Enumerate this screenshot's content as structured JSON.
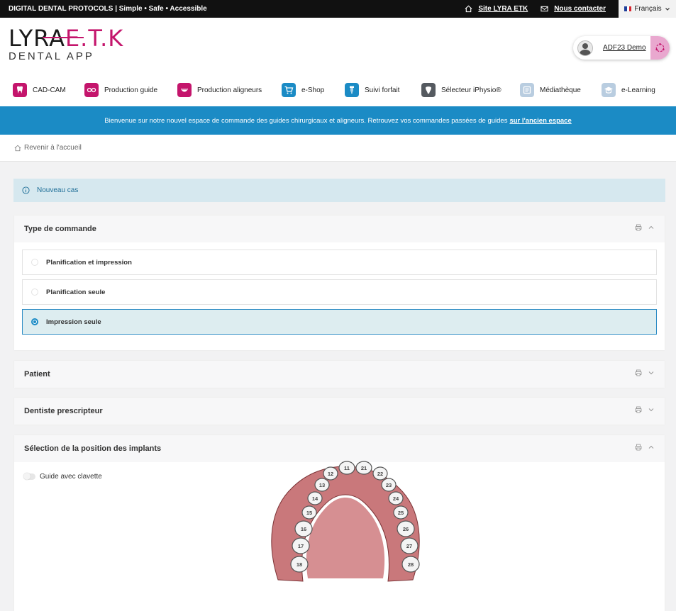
{
  "topbar": {
    "tagline": "DIGITAL DENTAL PROTOCOLS | Simple • Safe • Accessible",
    "site_link": "Site LYRA ETK",
    "contact_link": "Nous contacter",
    "language": "Français"
  },
  "brand": {
    "logo_line1": "LYRA",
    "logo_line1b": "E.T.K",
    "logo_line2": "DENTAL APP",
    "accent": "#c4156c"
  },
  "user": {
    "name": "ADF23 Demo"
  },
  "nav": [
    {
      "label": "CAD-CAM",
      "icon": "tooth-icon",
      "color": "#c4156c"
    },
    {
      "label": "Production guide",
      "icon": "guide-icon",
      "color": "#c4156c"
    },
    {
      "label": "Production aligneurs",
      "icon": "smile-icon",
      "color": "#c4156c"
    },
    {
      "label": "e-Shop",
      "icon": "cart-icon",
      "color": "#1b8bc5"
    },
    {
      "label": "Suivi forfait",
      "icon": "implant-icon",
      "color": "#1b8bc5"
    },
    {
      "label": "Sélecteur iPhysio®",
      "icon": "iphysio-icon",
      "color": "#555a60"
    },
    {
      "label": "Médiathèque",
      "icon": "media-icon",
      "color": "#b9cde0"
    },
    {
      "label": "e-Learning",
      "icon": "graduation-cap-icon",
      "color": "#b9cde0"
    }
  ],
  "banner": {
    "text": "Bienvenue sur notre nouvel espace de commande des guides chirurgicaux et aligneurs. Retrouvez vos commandes passées de guides",
    "link": "sur l'ancien espace"
  },
  "breadcrumb": {
    "back": "Revenir à l'accueil"
  },
  "alert": {
    "text": "Nouveau cas"
  },
  "sections": {
    "order_type": {
      "title": "Type de commande",
      "options": [
        {
          "label": "Planification et impression",
          "selected": false
        },
        {
          "label": "Planification seule",
          "selected": false
        },
        {
          "label": "Impression seule",
          "selected": true
        }
      ]
    },
    "patient": {
      "title": "Patient"
    },
    "dentist": {
      "title": "Dentiste prescripteur"
    },
    "implants": {
      "title": "Sélection de la position des implants",
      "toggle_label": "Guide avec clavette",
      "teeth": [
        "11",
        "12",
        "13",
        "14",
        "15",
        "16",
        "17",
        "18",
        "21",
        "22",
        "23",
        "24",
        "25",
        "26",
        "27",
        "28"
      ]
    }
  }
}
